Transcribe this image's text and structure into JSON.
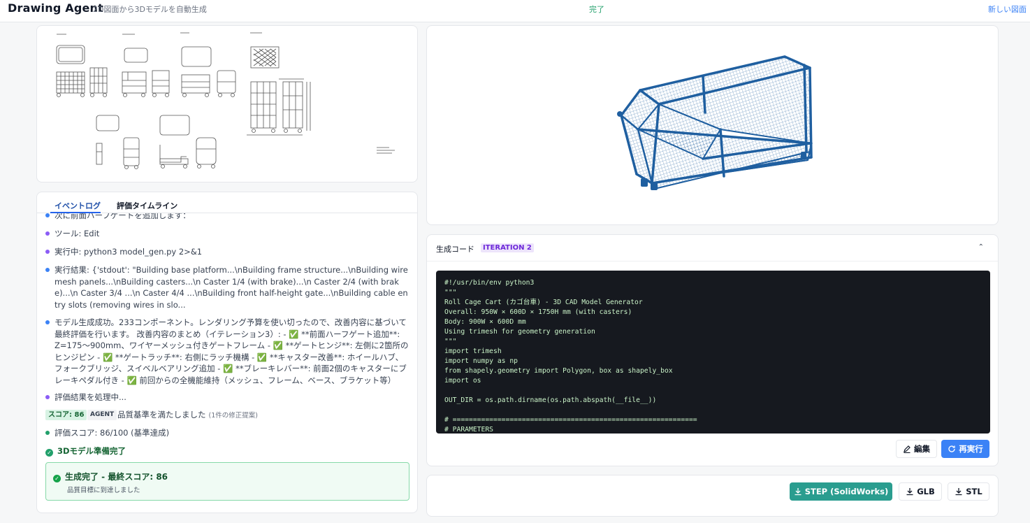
{
  "header": {
    "title": "Drawing Agent",
    "subtitle": "2D図面から3Dモデルを自動生成",
    "status": "完了",
    "new_drawing": "新しい図面"
  },
  "tabs": {
    "event_log": "イベントログ",
    "eval_timeline": "評価タイムライン"
  },
  "log": {
    "entries": [
      {
        "text": "次に前面ハーフゲートを追加します：",
        "color": "#3b82f6"
      },
      {
        "text": "ツール: Edit",
        "color": "#8b5cf6"
      },
      {
        "text": "実行中: python3 model_gen.py 2>&1",
        "color": "#8b5cf6"
      },
      {
        "text": "実行結果: {'stdout': \"Building base platform...\\nBuilding frame structure...\\nBuilding wire mesh panels...\\nBuilding casters...\\n Caster 1/4 (with brake)...\\n Caster 2/4 (with brake)...\\n Caster 3/4 ...\\n Caster 4/4 ...\\nBuilding front half-height gate...\\nBuilding cable entry slots (removing wires in slo...",
        "color": "#3b82f6"
      },
      {
        "text": "モデル生成成功。233コンポーネント。レンダリング予算を使い切ったので、改善内容に基づいて最終評価を行います。 改善内容のまとめ（イテレーション3）: - ✅ **前面ハーフゲート追加**: Z=175〜900mm、ワイヤーメッシュ付きゲートフレーム - ✅ **ゲートヒンジ**: 左側に2箇所のヒンジピン - ✅ **ゲートラッチ**: 右側にラッチ機構 - ✅ **キャスター改善**: ホイールハブ、フォークブリッジ、スイベルベアリング追加 - ✅ **ブレーキレバー**: 前面2個のキャスターにブレーキペダル付き - ✅ 前回からの全機能維持（メッシュ、フレーム、ベース、ブラケット等）",
        "color": "#3b82f6"
      },
      {
        "text": "評価結果を処理中...",
        "color": "#8b5cf6"
      }
    ],
    "score_badge": "スコア: 86",
    "agent_badge": "AGENT",
    "score_text": "品質基準を満たしました",
    "score_note": "(1件の修正提案)",
    "eval_score": "評価スコア: 86/100 (基準達成)",
    "ready": "3Dモデル準備完了",
    "done_title": "生成完了 - 最終スコア: 86",
    "done_sub": "品質目標に到達しました"
  },
  "code": {
    "title": "生成コード",
    "iteration": "ITERATION 2",
    "collapse_icon": "chevron-up-icon",
    "source": "#!/usr/bin/env python3\n\"\"\"\nRoll Cage Cart (カゴ台車) - 3D CAD Model Generator\nOverall: 950W × 600D × 1750H mm (with casters)\nBody: 900W × 600D mm\nUsing trimesh for geometry generation\n\"\"\"\nimport trimesh\nimport numpy as np\nfrom shapely.geometry import Polygon, box as shapely_box\nimport os\n\nOUT_DIR = os.path.dirname(os.path.abspath(__file__))\n\n# ============================================================\n# PARAMETERS",
    "edit": "編集",
    "rerun": "再実行"
  },
  "downloads": {
    "step": "STEP (SolidWorks)",
    "glb": "GLB",
    "stl": "STL"
  },
  "colors": {
    "accent": "#3b82f6",
    "teal": "#2a9d8f",
    "model_blue": "#1f5fa0",
    "success": "#22a06b"
  }
}
